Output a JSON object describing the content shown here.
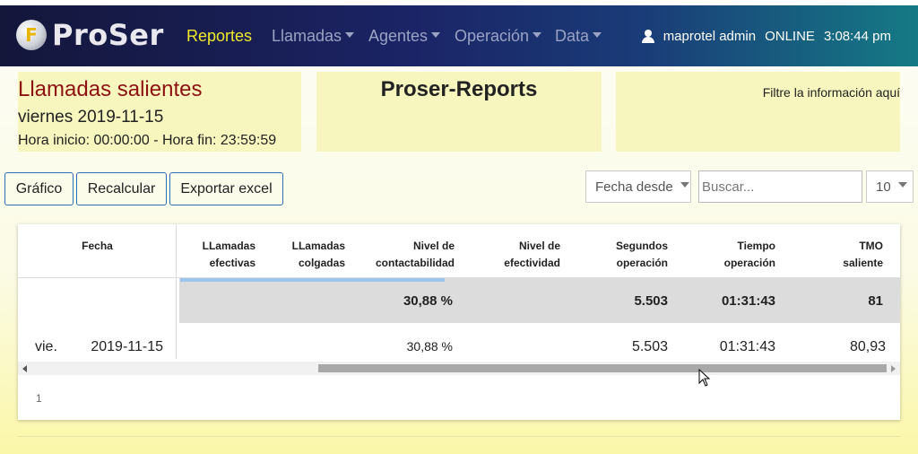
{
  "navbar": {
    "brand_name": "ProSer",
    "brand_glyph": "F",
    "items": [
      {
        "label": "Reportes",
        "active": true,
        "dropdown": false
      },
      {
        "label": "Llamadas",
        "active": false,
        "dropdown": true
      },
      {
        "label": "Agentes",
        "active": false,
        "dropdown": true
      },
      {
        "label": "Operación",
        "active": false,
        "dropdown": true
      },
      {
        "label": "Data",
        "active": false,
        "dropdown": true
      }
    ],
    "user": "maprotel admin",
    "status": "ONLINE",
    "time": "3:08:44 pm"
  },
  "header": {
    "report_title": "Llamadas salientes",
    "report_date": "viernes 2019-11-15",
    "report_hours": "Hora inicio: 00:00:00 - Hora fin: 23:59:59",
    "center_title": "Proser-Reports",
    "filter_hint": "Filtre la información aquí"
  },
  "toolbar": {
    "chart_button": "Gráfico",
    "recalc_button": "Recalcular",
    "export_button": "Exportar excel",
    "date_filter": "Fecha desde",
    "search_placeholder": "Buscar...",
    "page_size": "10"
  },
  "table": {
    "columns": [
      {
        "line1": "Fecha",
        "line2": ""
      },
      {
        "line1": "LLamadas",
        "line2": "efectivas"
      },
      {
        "line1": "LLamadas",
        "line2": "colgadas"
      },
      {
        "line1": "Nivel de",
        "line2": "contactabilidad"
      },
      {
        "line1": "Nivel de",
        "line2": "efectividad"
      },
      {
        "line1": "Segundos",
        "line2": "operación"
      },
      {
        "line1": "Tiempo",
        "line2": "operación"
      },
      {
        "line1": "TMO",
        "line2": "saliente"
      }
    ],
    "totals": {
      "contactabilidad": "30,88 %",
      "segundos": "5.503",
      "tiempo": "01:31:43",
      "tmo": "81"
    },
    "rows": [
      {
        "day": "vie.",
        "date": "2019-11-15",
        "contactabilidad": "30,88 %",
        "segundos": "5.503",
        "tiempo": "01:31:43",
        "tmo": "80,93"
      }
    ],
    "page": "1"
  },
  "colors": {
    "nav_active": "#f0e92a",
    "title_red": "#8e1111",
    "button_border": "#2a6fb8",
    "panel_bg": "#f8f6bf"
  }
}
